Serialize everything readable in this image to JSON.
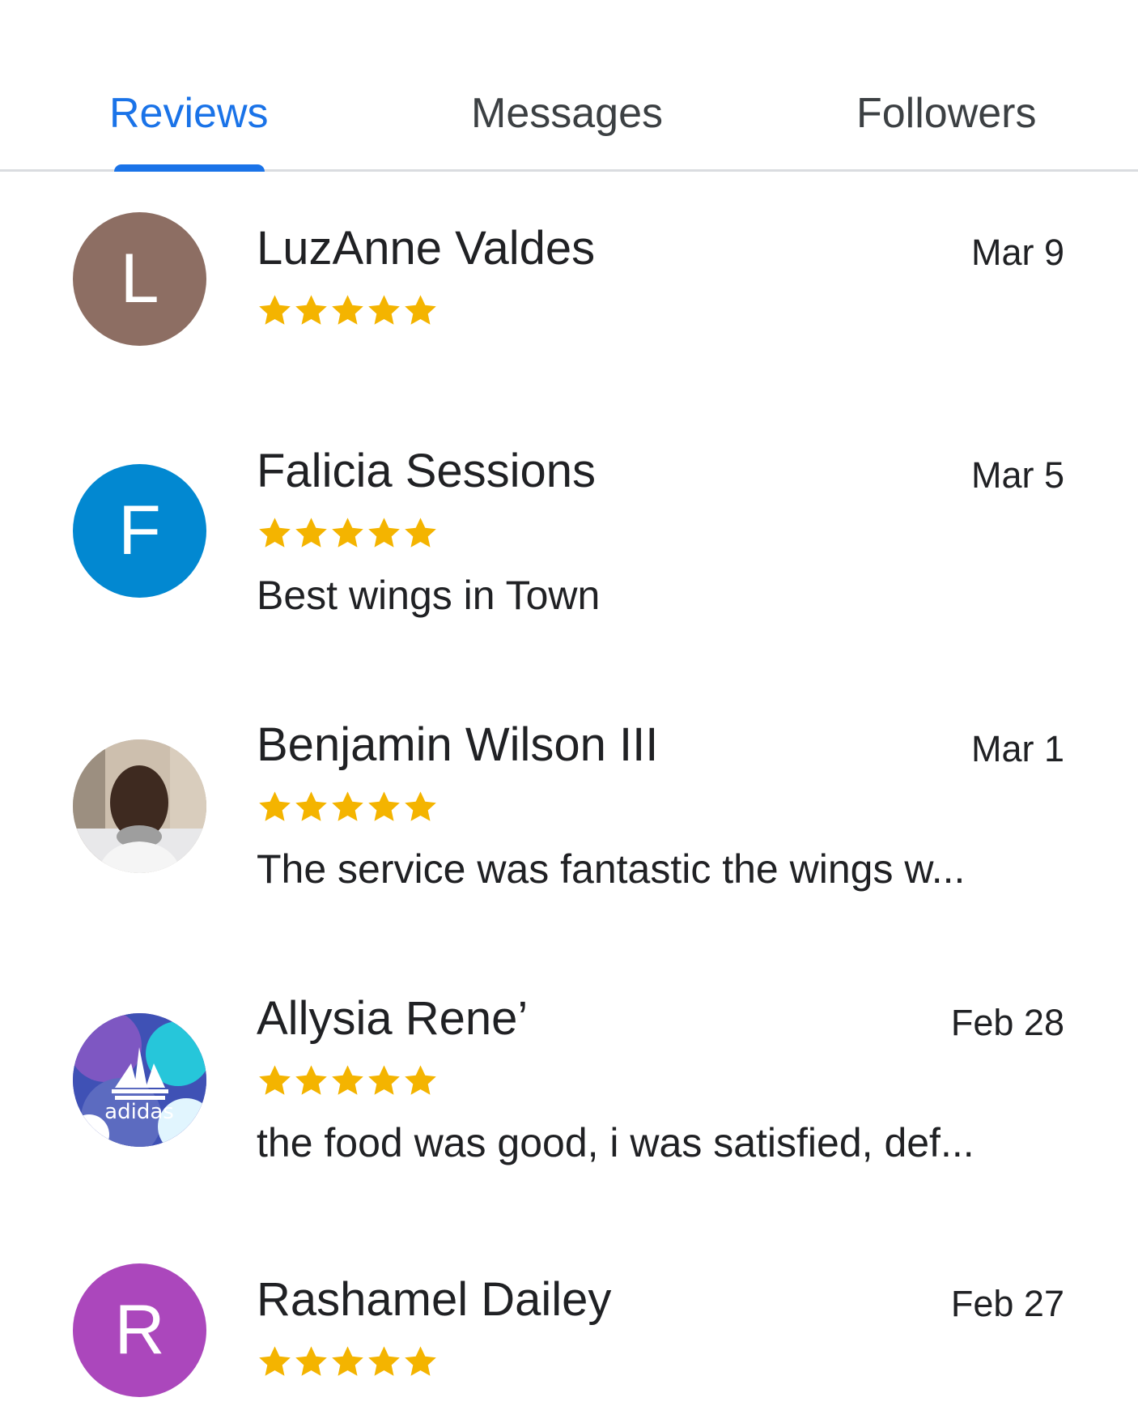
{
  "tabs": [
    {
      "label": "Reviews",
      "active": true
    },
    {
      "label": "Messages",
      "active": false
    },
    {
      "label": "Followers",
      "active": false
    }
  ],
  "colors": {
    "accent": "#1a73e8",
    "star": "#f4b400"
  },
  "reviews": [
    {
      "name": "LuzAnne Valdes",
      "date": "Mar 9",
      "rating": 5,
      "text": "",
      "avatar_letter": "L",
      "avatar_color": "#8d6e63"
    },
    {
      "name": "Falicia Sessions",
      "date": "Mar 5",
      "rating": 5,
      "text": "Best wings in Town",
      "avatar_letter": "F",
      "avatar_color": "#0288d1"
    },
    {
      "name": "Benjamin Wilson III",
      "date": "Mar 1",
      "rating": 5,
      "text": "The service was fantastic the wings w...",
      "avatar_letter": "",
      "avatar_color": "#b0a79a"
    },
    {
      "name": "Allysia Rene’",
      "date": "Feb 28",
      "rating": 5,
      "text": "the food was good, i was satisfied, def...",
      "avatar_letter": "",
      "avatar_color": "#4a3ba8",
      "avatar_logo_text": "adidas"
    },
    {
      "name": "Rashamel Dailey",
      "date": "Feb 27",
      "rating": 5,
      "text": "",
      "avatar_letter": "R",
      "avatar_color": "#ab47bc"
    }
  ]
}
